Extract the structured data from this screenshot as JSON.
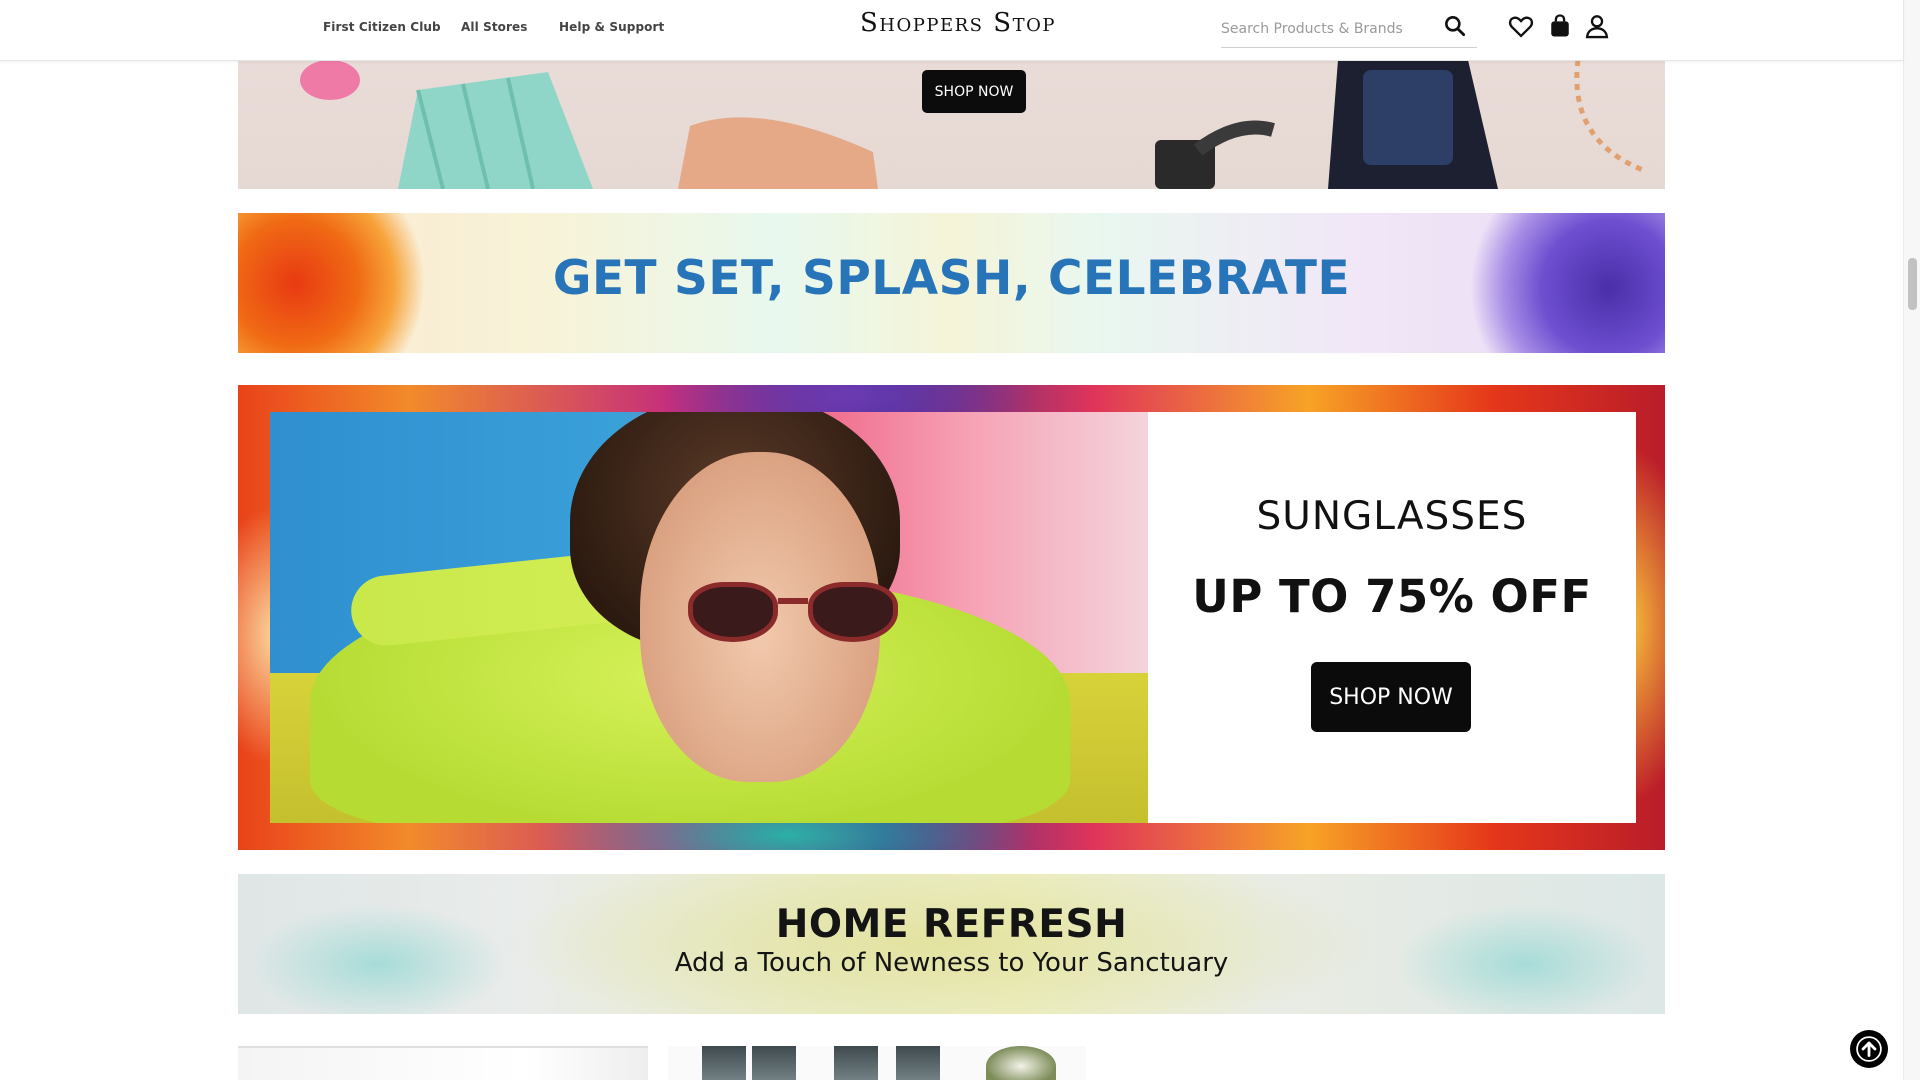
{
  "header": {
    "nav": [
      "First Citizen Club",
      "All Stores",
      "Help & Support"
    ],
    "logo": "Shoppers Stop",
    "search": {
      "placeholder": "Search Products & Brands",
      "value": ""
    },
    "icons": [
      "search-icon",
      "heart-icon",
      "bag-icon",
      "user-icon"
    ]
  },
  "banners": {
    "accessories": {
      "button": "SHOP NOW"
    },
    "holi": {
      "title": "GET SET, SPLASH, CELEBRATE",
      "title_color": "#2775b8"
    },
    "sunglasses": {
      "category": "SUNGLASSES",
      "offer": "UP TO 75% OFF",
      "button": "SHOP NOW"
    },
    "home": {
      "title": "HOME REFRESH",
      "subtitle": "Add a Touch of Newness to Your Sanctuary"
    }
  },
  "controls": {
    "back_to_top_icon": "arrow-up-icon"
  },
  "colors": {
    "button_bg": "#0c0c0c",
    "accent_blue": "#2775b8"
  }
}
